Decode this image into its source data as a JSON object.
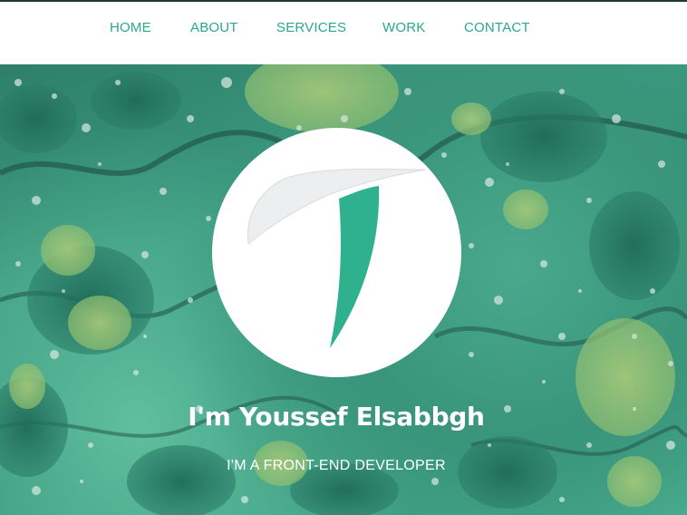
{
  "nav": {
    "items": [
      {
        "label": "HOME"
      },
      {
        "label": "ABOUT"
      },
      {
        "label": "SERVICES"
      },
      {
        "label": "WORK"
      },
      {
        "label": "CONTACT"
      }
    ]
  },
  "hero": {
    "logo_icon": "t-logo-icon",
    "title": "I'm Youssef Elsabbgh",
    "subtitle": "I'M A FRONT-END DEVELOPER"
  },
  "colors": {
    "accent": "#2aa88a",
    "logo_green": "#2fb08f",
    "logo_gray": "#eceeef",
    "hero_base": "#3b9a7f"
  }
}
